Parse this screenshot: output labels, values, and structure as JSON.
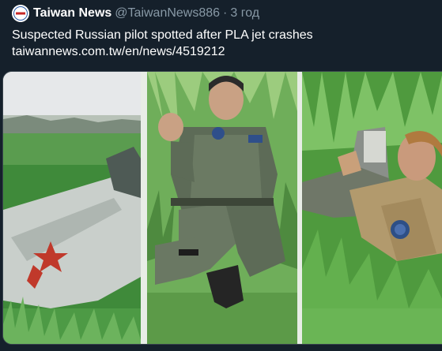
{
  "tweet": {
    "author_name": "Taiwan News",
    "author_handle": "@TaiwanNews886",
    "separator": "·",
    "timestamp": "3 год",
    "text_line1": "Suspected Russian pilot spotted after PLA jet crashes",
    "text_line2": "taiwannews.com.tw/en/news/4519212",
    "avatar_text": "Taiwan News"
  },
  "media": {
    "panels": [
      "jet-wreckage-in-field",
      "seated-pilot-in-grass",
      "pilot-lying-in-grass"
    ]
  },
  "colors": {
    "background": "#15202b",
    "text_primary": "#ffffff",
    "text_secondary": "#8899a6",
    "border": "#38444d"
  }
}
